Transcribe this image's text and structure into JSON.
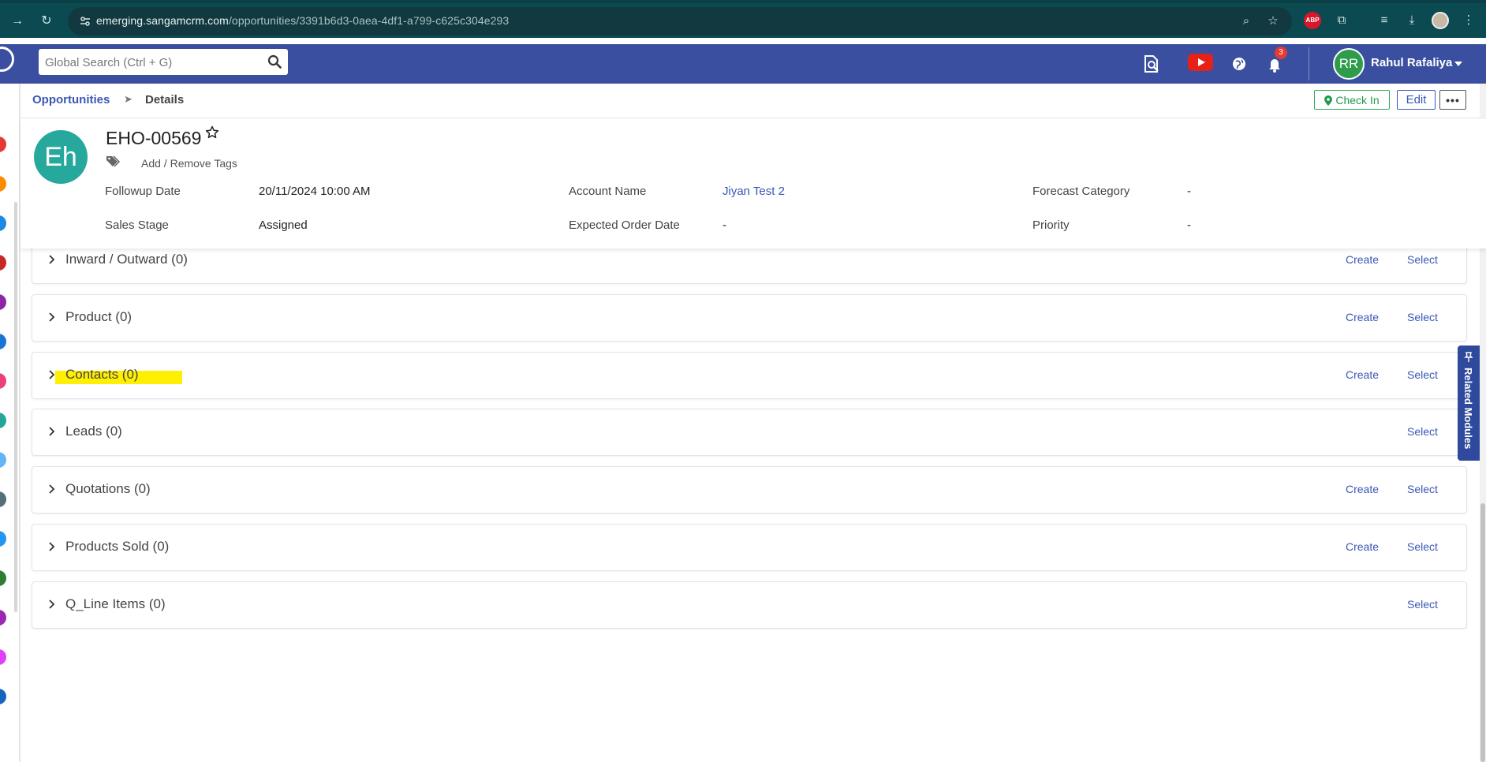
{
  "browser": {
    "url_host": "emerging.sangamcrm.com",
    "url_path": "/opportunities/3391b6d3-0aea-4df1-a799-c625c304e293"
  },
  "header": {
    "search_placeholder": "Global Search (Ctrl + G)",
    "notification_count": "3",
    "user_initials": "RR",
    "user_name": "Rahul Rafaliya"
  },
  "breadcrumb": {
    "parent": "Opportunities",
    "separator": "➤",
    "current": "Details"
  },
  "actions": {
    "check_in": "Check In",
    "edit": "Edit",
    "more": "•••"
  },
  "record": {
    "avatar_initials": "Eh",
    "title": "EHO-00569",
    "tags_link": "Add / Remove Tags",
    "fields": [
      {
        "label": "Followup Date",
        "value": "20/11/2024 10:00 AM"
      },
      {
        "label": "Account Name",
        "value": "Jiyan Test 2"
      },
      {
        "label": "Forecast Category",
        "value": "-"
      },
      {
        "label": "Sales Stage",
        "value": "Assigned"
      },
      {
        "label": "Expected Order Date",
        "value": "-"
      },
      {
        "label": "Priority",
        "value": "-"
      }
    ]
  },
  "panels": [
    {
      "title": "Inward / Outward (0)",
      "create": "Create",
      "select": "Select"
    },
    {
      "title": "Product (0)",
      "create": "Create",
      "select": "Select"
    },
    {
      "title": "Contacts (0)",
      "create": "Create",
      "select": "Select"
    },
    {
      "title": "Leads (0)",
      "select": "Select"
    },
    {
      "title": "Quotations (0)",
      "create": "Create",
      "select": "Select"
    },
    {
      "title": "Products Sold (0)",
      "create": "Create",
      "select": "Select"
    },
    {
      "title": "Q_Line Items (0)",
      "select": "Select"
    }
  ],
  "related_modules_tab": "Related Modules",
  "colors": {
    "header_bg": "#3a4fa0",
    "link": "#3a57b5",
    "check_in_green": "#1f9a4c",
    "avatar_teal": "#27a89c",
    "highlight": "#ffef00",
    "browser_bg": "#0c4a52"
  },
  "rail_icon_colors": [
    "#e53935",
    "#fb8c00",
    "#1e88e5",
    "#c62828",
    "#8e24aa",
    "#1976d2",
    "#ec407a",
    "#26a69a",
    "#64b5f6",
    "#546e7a",
    "#2196f3",
    "#2e7d32",
    "#9c27b0",
    "#e040fb",
    "#1565c0"
  ]
}
